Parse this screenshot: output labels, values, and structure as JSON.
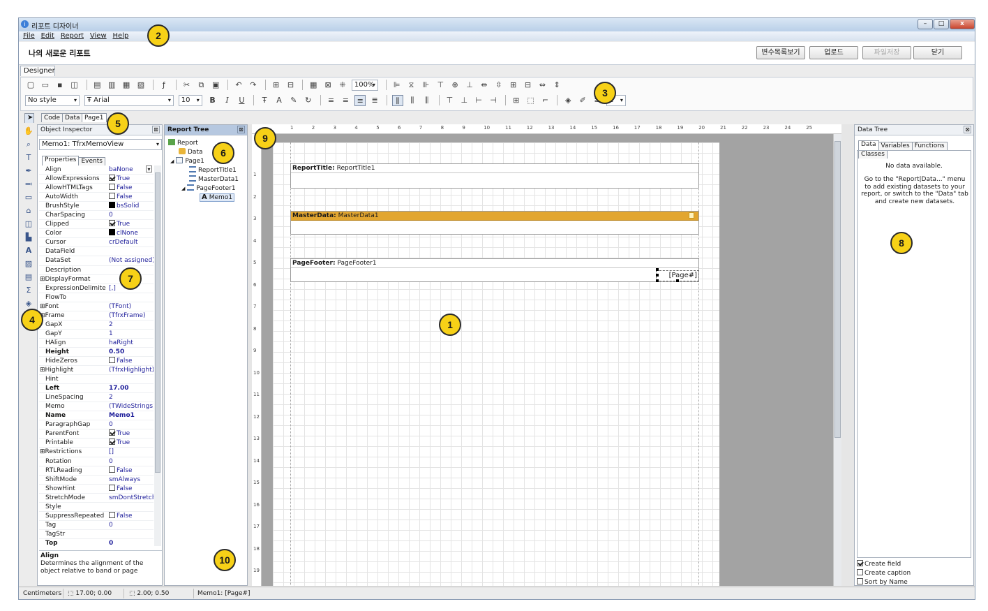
{
  "window": {
    "title": "리포트 디자이너",
    "controls": {
      "minimize": "–",
      "maximize": "□",
      "close": "x"
    }
  },
  "menu": {
    "items": [
      {
        "label": "File"
      },
      {
        "label": "Edit"
      },
      {
        "label": "Report"
      },
      {
        "label": "View"
      },
      {
        "label": "Help"
      }
    ]
  },
  "header": {
    "report_title": "나의 새로운 리포트",
    "buttons": [
      {
        "label": "변수목록보기",
        "enabled": true
      },
      {
        "label": "업로드",
        "enabled": true
      },
      {
        "label": "파일저장",
        "enabled": false
      },
      {
        "label": "닫기",
        "enabled": true
      }
    ]
  },
  "designer_tab": "Designer",
  "toolbar": {
    "zoom": "100%",
    "style_combo": "No style",
    "font_combo": "Arial",
    "size_combo": "10",
    "frame_width": "1",
    "bold": "B",
    "italic": "I",
    "underline": "U"
  },
  "mode_tabs": [
    "Code",
    "Data",
    "Page1"
  ],
  "object_inspector": {
    "title": "Object Inspector",
    "selected": "Memo1: TfrxMemoView",
    "tabs": [
      "Properties",
      "Events"
    ],
    "properties": [
      {
        "name": "Align",
        "value": "baNone"
      },
      {
        "name": "AllowExpressions",
        "value": "True",
        "check": true
      },
      {
        "name": "AllowHTMLTags",
        "value": "False",
        "check": false
      },
      {
        "name": "AutoWidth",
        "value": "False",
        "check": false
      },
      {
        "name": "BrushStyle",
        "value": "bsSolid",
        "swatch": true
      },
      {
        "name": "CharSpacing",
        "value": "0"
      },
      {
        "name": "Clipped",
        "value": "True",
        "check": true
      },
      {
        "name": "Color",
        "value": "clNone",
        "swatch": true
      },
      {
        "name": "Cursor",
        "value": "crDefault"
      },
      {
        "name": "DataField",
        "value": ""
      },
      {
        "name": "DataSet",
        "value": "(Not assigned)"
      },
      {
        "name": "Description",
        "value": ""
      },
      {
        "name": "DisplayFormat",
        "value": "",
        "expand": true
      },
      {
        "name": "ExpressionDelimiters",
        "value": "[,]"
      },
      {
        "name": "FlowTo",
        "value": ""
      },
      {
        "name": "Font",
        "value": "(TFont)",
        "expand": true
      },
      {
        "name": "Frame",
        "value": "(TfrxFrame)",
        "expand": true
      },
      {
        "name": "GapX",
        "value": "2"
      },
      {
        "name": "GapY",
        "value": "1"
      },
      {
        "name": "HAlign",
        "value": "haRight"
      },
      {
        "name": "Height",
        "value": "0.50",
        "bold": true
      },
      {
        "name": "HideZeros",
        "value": "False",
        "check": false
      },
      {
        "name": "Highlight",
        "value": "(TfrxHighlight)",
        "expand": true
      },
      {
        "name": "Hint",
        "value": ""
      },
      {
        "name": "Left",
        "value": "17.00",
        "bold": true
      },
      {
        "name": "LineSpacing",
        "value": "2"
      },
      {
        "name": "Memo",
        "value": "(TWideStrings)"
      },
      {
        "name": "Name",
        "value": "Memo1",
        "bold": true
      },
      {
        "name": "ParagraphGap",
        "value": "0"
      },
      {
        "name": "ParentFont",
        "value": "True",
        "check": true
      },
      {
        "name": "Printable",
        "value": "True",
        "check": true
      },
      {
        "name": "Restrictions",
        "value": "[]",
        "expand": true
      },
      {
        "name": "Rotation",
        "value": "0"
      },
      {
        "name": "RTLReading",
        "value": "False",
        "check": false
      },
      {
        "name": "ShiftMode",
        "value": "smAlways"
      },
      {
        "name": "ShowHint",
        "value": "False",
        "check": false
      },
      {
        "name": "StretchMode",
        "value": "smDontStretch"
      },
      {
        "name": "Style",
        "value": ""
      },
      {
        "name": "SuppressRepeated",
        "value": "False",
        "check": false
      },
      {
        "name": "Tag",
        "value": "0"
      },
      {
        "name": "TagStr",
        "value": ""
      },
      {
        "name": "Top",
        "value": "0",
        "bold": true
      }
    ],
    "description_title": "Align",
    "description_text": "Determines the alignment of the object relative to band or page"
  },
  "report_tree": {
    "title": "Report Tree",
    "items": [
      {
        "label": "Report",
        "icon": "report-icon"
      },
      {
        "label": "Data",
        "icon": "database-icon"
      },
      {
        "label": "Page1",
        "icon": "page-icon"
      },
      {
        "label": "ReportTitle1",
        "icon": "band-icon"
      },
      {
        "label": "MasterData1",
        "icon": "band-icon"
      },
      {
        "label": "PageFooter1",
        "icon": "band-icon"
      },
      {
        "label": "Memo1",
        "icon": "memo-icon"
      }
    ]
  },
  "page": {
    "bands": [
      {
        "type": "ReportTitle:",
        "name": "ReportTitle1"
      },
      {
        "type": "MasterData:",
        "name": "MasterData1"
      },
      {
        "type": "PageFooter:",
        "name": "PageFooter1"
      }
    ],
    "memo_text": "[Page#]"
  },
  "data_tree": {
    "title": "Data Tree",
    "tabs": [
      "Data",
      "Variables",
      "Functions",
      "Classes"
    ],
    "no_data": "No data available.",
    "hint": "Go to the \"Report|Data...\" menu to add existing datasets to your report, or switch to the \"Data\" tab and create new datasets.",
    "options": [
      {
        "label": "Create field",
        "checked": true
      },
      {
        "label": "Create caption",
        "checked": false
      },
      {
        "label": "Sort by Name",
        "checked": false
      }
    ]
  },
  "status": {
    "units": "Centimeters",
    "position": "17.00; 0.00",
    "size": "2.00; 0.50",
    "object": "Memo1: [Page#]"
  },
  "callouts": [
    "1",
    "2",
    "3",
    "4",
    "5",
    "6",
    "7",
    "8",
    "9",
    "10"
  ],
  "colors": {
    "accent": "#f7d117",
    "masterdata_band": "#e2a630",
    "report_tree_header": "#b6c8e0",
    "workspace": "#a3a3a3"
  }
}
